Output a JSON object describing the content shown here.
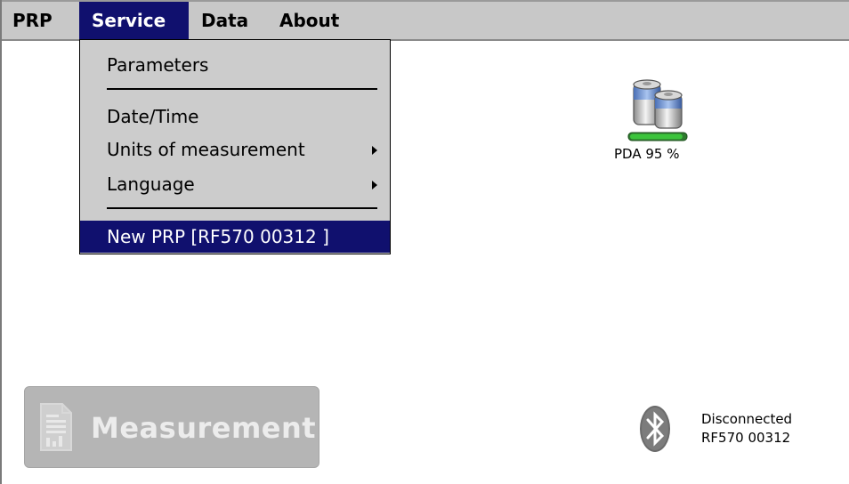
{
  "menubar": {
    "items": [
      {
        "label": "PRP"
      },
      {
        "label": "Service"
      },
      {
        "label": "Data"
      },
      {
        "label": "About"
      }
    ]
  },
  "service_menu": {
    "parameters": "Parameters",
    "date_time": "Date/Time",
    "units": "Units of measurement",
    "language": "Language",
    "new_prp": "New PRP [RF570 00312 ]"
  },
  "battery": {
    "label": "PDA 95 %",
    "level_percent": 95,
    "icon": "battery-icon"
  },
  "measurement_button": {
    "label": "Measurement",
    "icon": "document-icon",
    "enabled": false
  },
  "connection": {
    "status": "Disconnected",
    "device": "RF570 00312",
    "icon": "bluetooth-icon"
  },
  "colors": {
    "menu_highlight": "#10106e",
    "menubar_bg": "#c8c8c8",
    "dropdown_bg": "#cccccc",
    "button_disabled_bg": "#b5b5b5",
    "battery_fill": "#3cc43c"
  }
}
